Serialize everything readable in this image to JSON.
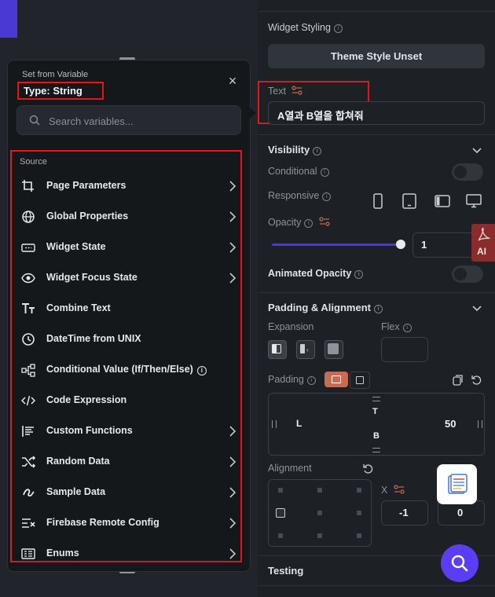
{
  "popup": {
    "title": "Set from Variable",
    "type_label": "Type: String",
    "close_glyph": "×",
    "search_placeholder": "Search variables...",
    "source_label": "Source",
    "items": [
      {
        "label": "Page Parameters",
        "icon": "crop-icon",
        "chevron": true
      },
      {
        "label": "Global Properties",
        "icon": "globe-icon",
        "chevron": true
      },
      {
        "label": "Widget State",
        "icon": "widget-state-icon",
        "chevron": true
      },
      {
        "label": "Widget Focus State",
        "icon": "eye-icon",
        "chevron": true
      },
      {
        "label": "Combine Text",
        "icon": "text-format-icon",
        "chevron": false
      },
      {
        "label": "DateTime from UNIX",
        "icon": "clock-icon",
        "chevron": false
      },
      {
        "label": "Conditional Value (If/Then/Else)",
        "icon": "branch-icon",
        "chevron": false,
        "info": true
      },
      {
        "label": "Code Expression",
        "icon": "code-icon",
        "chevron": false
      },
      {
        "label": "Custom Functions",
        "icon": "functions-icon",
        "chevron": true
      },
      {
        "label": "Random Data",
        "icon": "shuffle-icon",
        "chevron": true
      },
      {
        "label": "Sample Data",
        "icon": "sample-data-icon",
        "chevron": true
      },
      {
        "label": "Firebase Remote Config",
        "icon": "remote-config-icon",
        "chevron": true
      },
      {
        "label": "Enums",
        "icon": "enums-icon",
        "chevron": true
      }
    ]
  },
  "panel": {
    "widget_styling": "Widget Styling",
    "theme_button": "Theme Style Unset",
    "text_label": "Text",
    "text_value": "A열과 B열을 합쳐줘",
    "visibility": "Visibility",
    "conditional": "Conditional",
    "responsive": "Responsive",
    "opacity": "Opacity",
    "opacity_value": "1",
    "opacity_fraction": 1,
    "animated_opacity": "Animated Opacity",
    "padding_alignment": "Padding & Alignment",
    "expansion": "Expansion",
    "flex": "Flex",
    "padding": "Padding",
    "pad_top": "T",
    "pad_left": "L",
    "pad_right": "50",
    "pad_bottom": "B",
    "alignment": "Alignment",
    "x_label": "X",
    "x_value": "-1",
    "y_value": "0",
    "testing": "Testing",
    "ai_badge": "AI"
  },
  "colors": {
    "accent": "#4b39d4",
    "highlight_red": "#e8141b",
    "padding_active": "#c86c4f"
  }
}
